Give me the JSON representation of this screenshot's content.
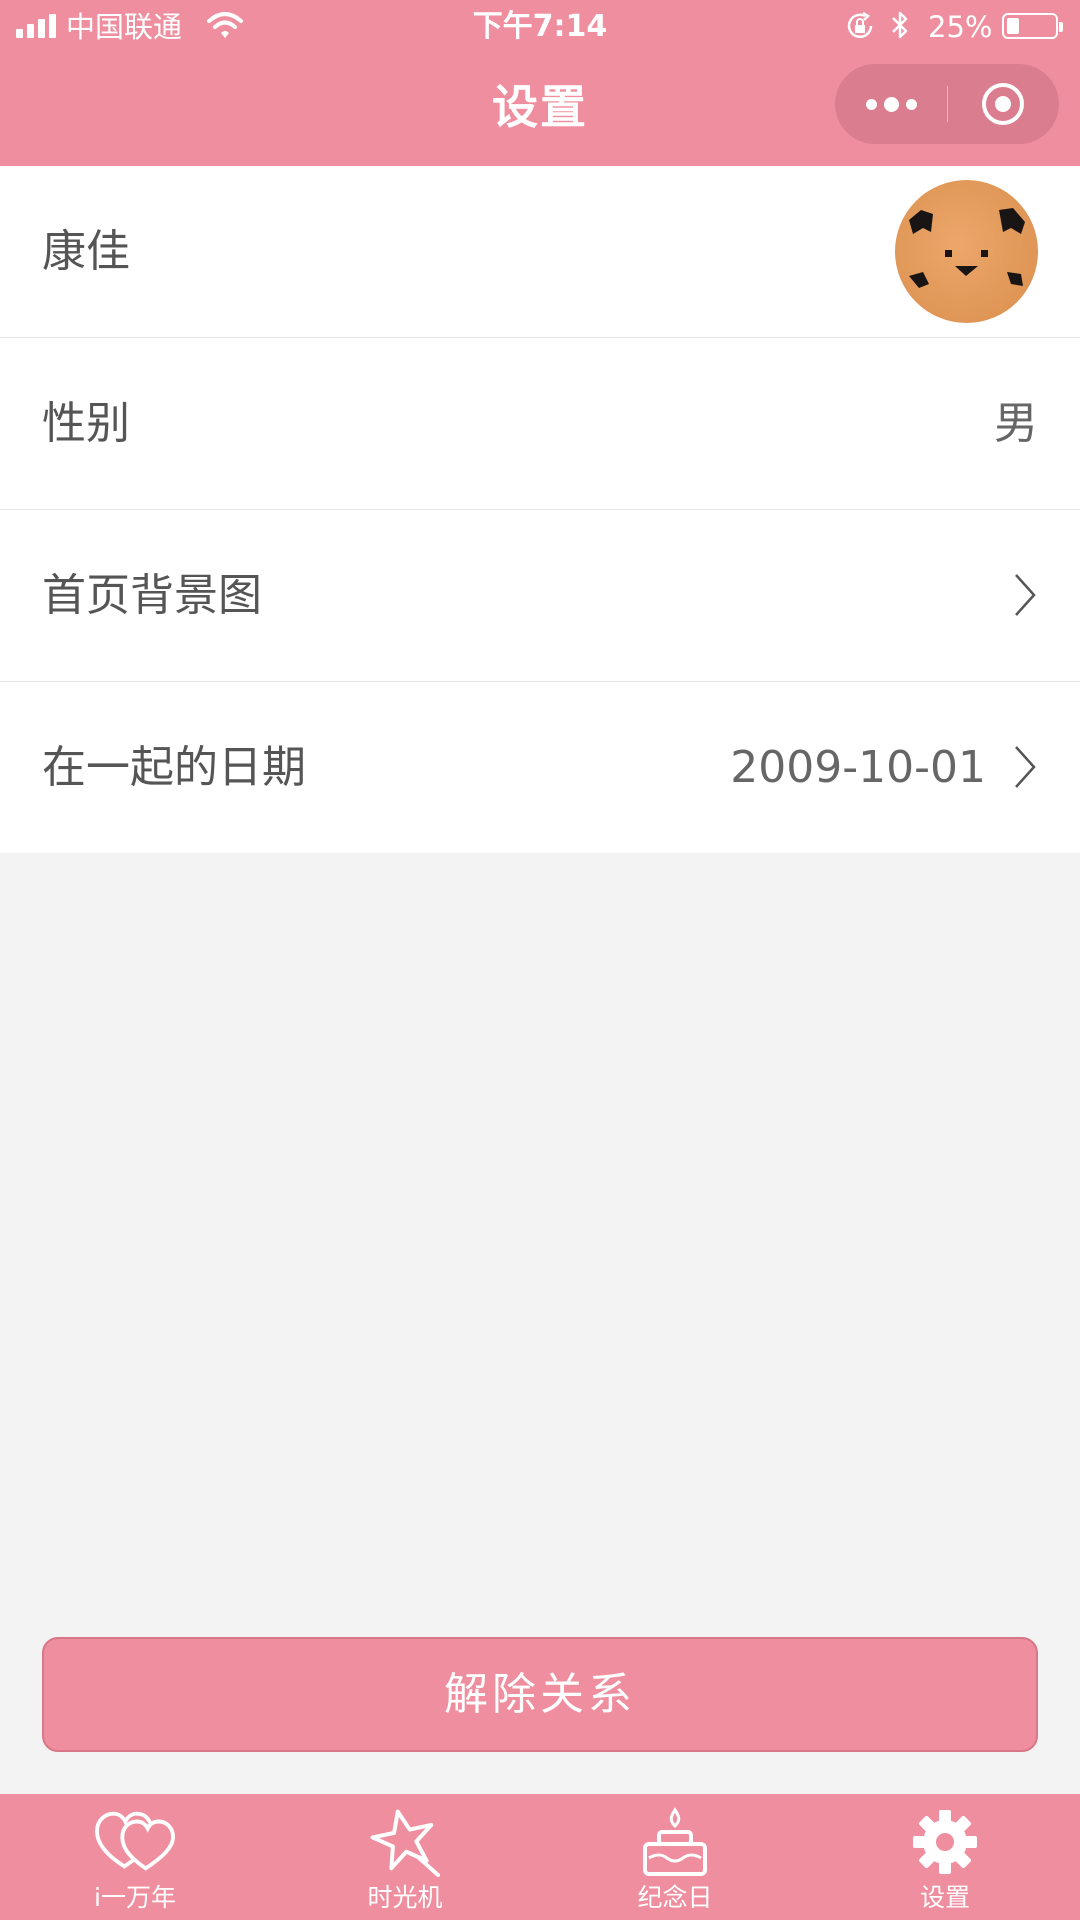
{
  "status_bar": {
    "carrier": "中国联通",
    "time": "下午7:14",
    "battery_percent": "25%",
    "battery_level": 0.25,
    "signal_bars": 4
  },
  "nav": {
    "title": "设置",
    "more_icon": "more-dots-icon",
    "close_icon": "target-circle-icon"
  },
  "settings": {
    "name": {
      "label": "康佳",
      "avatar_icon": "dog-face-avatar"
    },
    "gender": {
      "label": "性别",
      "value": "男"
    },
    "background": {
      "label": "首页背景图"
    },
    "together_date": {
      "label": "在一起的日期",
      "value": "2009-10-01"
    }
  },
  "unbind_button": "解除关系",
  "tabbar": {
    "items": [
      {
        "label": "i一万年",
        "icon": "two-hearts-icon"
      },
      {
        "label": "时光机",
        "icon": "star-wand-icon"
      },
      {
        "label": "纪念日",
        "icon": "cake-icon"
      },
      {
        "label": "设置",
        "icon": "gear-icon"
      }
    ]
  },
  "colors": {
    "brand_pink": "#ee8e9e",
    "page_bg": "#f3f3f3",
    "text_gray": "#555555"
  }
}
